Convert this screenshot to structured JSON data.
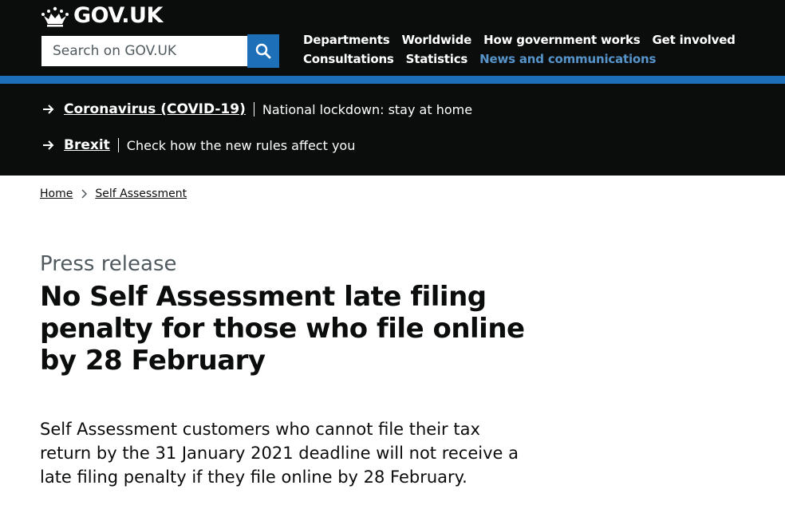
{
  "header": {
    "logo_text": "GOV.UK",
    "search": {
      "placeholder": "Search on GOV.UK"
    },
    "nav": [
      {
        "label": "Departments"
      },
      {
        "label": "Worldwide"
      },
      {
        "label": "How government works"
      },
      {
        "label": "Get involved"
      },
      {
        "label": "Consultations"
      },
      {
        "label": "Statistics"
      },
      {
        "label": "News and communications",
        "active": true
      }
    ]
  },
  "banner": {
    "items": [
      {
        "link": "Coronavirus (COVID-19)",
        "text": "National lockdown: stay at home"
      },
      {
        "link": "Brexit",
        "text": "Check how the new rules affect you"
      }
    ]
  },
  "breadcrumb": [
    {
      "label": "Home"
    },
    {
      "label": "Self Assessment"
    }
  ],
  "article": {
    "kicker": "Press release",
    "title": "No Self Assessment late filing penalty for those who file online by 28 February",
    "lead": "Self Assessment customers who cannot file their tax return by the 31 January 2021 deadline will not receive a late filing penalty if they file online by 28 February."
  },
  "colors": {
    "header_bg": "#0b0c0c",
    "brand_blue": "#1d70b8",
    "active_nav": "#5694ca"
  }
}
